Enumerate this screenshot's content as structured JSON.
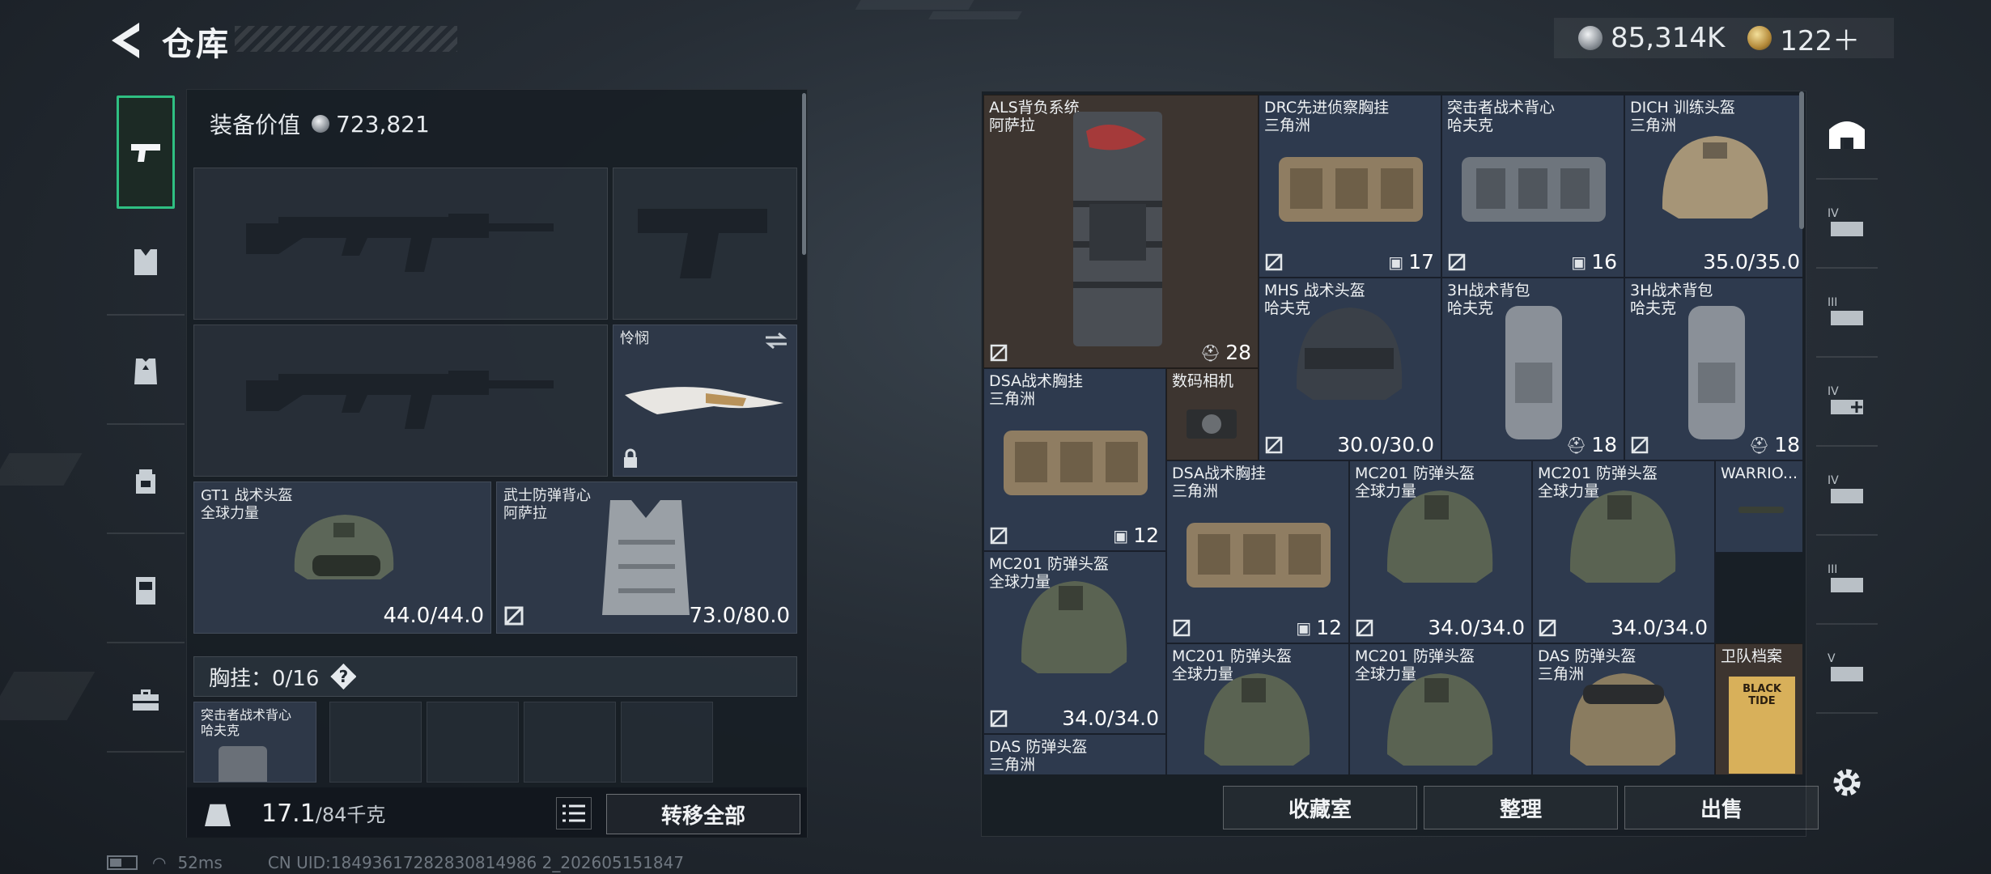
{
  "header": {
    "title": "仓库"
  },
  "currency": {
    "silver": "85,314K",
    "gold": "122＋"
  },
  "rail": {
    "items": [
      {
        "icon": "pistol-icon",
        "active": true
      },
      {
        "icon": "chest-rig-icon"
      },
      {
        "icon": "armor-vest-icon"
      },
      {
        "icon": "backpack-icon"
      },
      {
        "icon": "safe-box-icon"
      },
      {
        "icon": "toolbox-icon"
      }
    ]
  },
  "loadout": {
    "value_label": "装备价值",
    "value": "723,821",
    "melee": {
      "name": "怜悯"
    },
    "helmet": {
      "name": "GT1 战术头盔",
      "brand": "全球力量",
      "durability": "44.0/44.0"
    },
    "armor": {
      "name": "武士防弹背心",
      "brand": "阿萨拉",
      "durability": "73.0/80.0"
    },
    "chest": {
      "label": "胸挂：0/16",
      "help": "?"
    },
    "chest_item": {
      "name": "突击者战术背心",
      "brand": "哈夫克"
    },
    "weight": "17.1",
    "weight_max": "/84千克",
    "move_all": "转移全部"
  },
  "storage": {
    "items": [
      {
        "name": "ALS背负系统",
        "brand": "阿萨拉",
        "value": "28"
      },
      {
        "name": "DRC先进侦察胸挂",
        "brand": "三角洲",
        "value": "17"
      },
      {
        "name": "突击者战术背心",
        "brand": "哈夫克",
        "value": "16"
      },
      {
        "name": "DICH 训练头盔",
        "brand": "三角洲",
        "value": "35.0/35.0"
      },
      {
        "name": "MHS 战术头盔",
        "brand": "哈夫克",
        "value": "30.0/30.0"
      },
      {
        "name": "3H战术背包",
        "brand": "哈夫克",
        "value": "18"
      },
      {
        "name": "3H战术背包",
        "brand": "哈夫克",
        "value": "18"
      },
      {
        "name": "DSA战术胸挂",
        "brand": "三角洲",
        "value": "12"
      },
      {
        "name": "数码相机",
        "brand": "",
        "value": ""
      },
      {
        "name": "DSA战术胸挂",
        "brand": "三角洲",
        "value": "12"
      },
      {
        "name": "MC201 防弹头盔",
        "brand": "全球力量",
        "value": "34.0/34.0"
      },
      {
        "name": "MC201 防弹头盔",
        "brand": "全球力量",
        "value": "34.0/34.0"
      },
      {
        "name": "WARRIO...",
        "brand": "",
        "value": ""
      },
      {
        "name": "MC201 防弹头盔",
        "brand": "全球力量",
        "value": "34.0/34.0"
      },
      {
        "name": "MC201 防弹头盔",
        "brand": "全球力量",
        "value": ""
      },
      {
        "name": "MC201 防弹头盔",
        "brand": "全球力量",
        "value": ""
      },
      {
        "name": "DAS 防弹头盔",
        "brand": "三角洲",
        "value": ""
      },
      {
        "name": "卫队档案",
        "brand": "",
        "value": "",
        "art_text": "BLACK TIDE"
      },
      {
        "name": "DAS 防弹头盔",
        "brand": "三角洲",
        "value": ""
      }
    ],
    "actions": {
      "collection": "收藏室",
      "sort": "整理",
      "sell": "出售"
    }
  },
  "right_rail": {
    "items": [
      {
        "icon": "storage-home-icon"
      },
      {
        "icon": "storage-tab-4-icon",
        "label": "IV"
      },
      {
        "icon": "storage-tab-3-icon",
        "label": "III"
      },
      {
        "icon": "storage-tab-4-medic-icon",
        "label": "IV"
      },
      {
        "icon": "storage-tab-4-folder-icon",
        "label": "IV"
      },
      {
        "icon": "storage-tab-3-armor-icon",
        "label": "III"
      },
      {
        "icon": "storage-tab-5-icon",
        "label": "V"
      },
      {
        "icon": "settings-gear-icon"
      }
    ]
  },
  "status": {
    "ping": "52ms",
    "uid": "CN UID:18493617282830814986 2_202605151847"
  },
  "colors": {
    "accent": "#2fbf82",
    "panel": "#181e25",
    "cell_blue": "#2e3a4e",
    "cell_brown": "#3b3430"
  }
}
